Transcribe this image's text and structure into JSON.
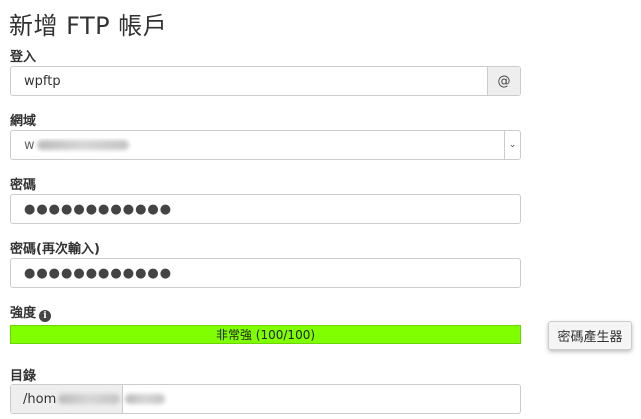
{
  "page": {
    "title": "新增 FTP 帳戶"
  },
  "login": {
    "label": "登入",
    "value": "wpftp",
    "addon": "@"
  },
  "domain": {
    "label": "網域",
    "value": "w",
    "arrow": "⌄"
  },
  "password": {
    "label": "密碼",
    "value": "●●●●●●●●●●●●"
  },
  "password_confirm": {
    "label": "密碼(再次輸入)",
    "value": "●●●●●●●●●●●●"
  },
  "strength": {
    "label": "強度",
    "info_icon": "i",
    "text": "非常強 (100/100)",
    "level": 100,
    "color": "#7fff00"
  },
  "generator": {
    "label": "密碼產生器"
  },
  "directory": {
    "label": "目錄",
    "prefix": "/hom"
  }
}
